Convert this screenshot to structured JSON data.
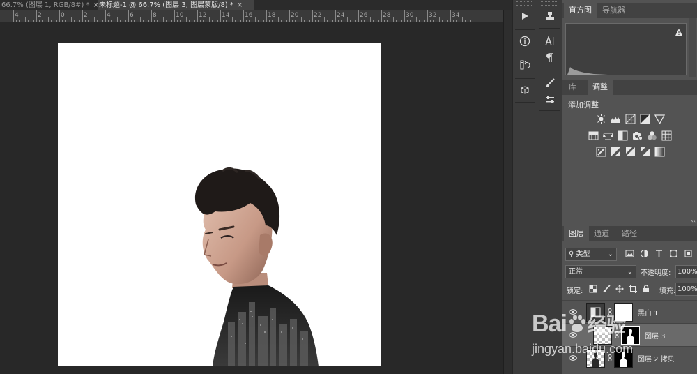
{
  "document_tabs": [
    {
      "label": "66.7% (图层 1, RGB/8#) *",
      "close": "×",
      "active": false
    },
    {
      "label": "未标题-1 @ 66.7% (图层 3, 图层蒙版/8) *",
      "close": "×",
      "active": true
    }
  ],
  "ruler": {
    "labels": [
      "4",
      "2",
      "0",
      "2",
      "4",
      "6",
      "8",
      "10",
      "12",
      "14",
      "16",
      "18",
      "20",
      "22",
      "24",
      "26",
      "28",
      "30",
      "32",
      "34"
    ]
  },
  "histogram_panel": {
    "tabs": [
      "直方图",
      "导航器"
    ],
    "active_tab": 0,
    "warning_icon": "warning-icon"
  },
  "adjustments_panel": {
    "tabs": [
      "库",
      "调整"
    ],
    "active_tab": 1,
    "heading": "添加调整",
    "icon_rows": [
      [
        "brightness-contrast-icon",
        "levels-icon",
        "curves-icon",
        "exposure-icon",
        "vibrance-icon"
      ],
      [
        "hue-saturation-icon",
        "color-balance-icon",
        "black-white-icon",
        "photo-filter-icon",
        "channel-mixer-icon",
        "color-lookup-icon"
      ],
      [
        "invert-icon",
        "posterize-icon",
        "threshold-icon",
        "selective-color-icon",
        "gradient-map-icon"
      ]
    ]
  },
  "layers_panel": {
    "tabs": [
      "图层",
      "通道",
      "路径"
    ],
    "active_tab": 0,
    "filter_kind": "类型",
    "blend_mode": "正常",
    "opacity_label": "不透明度:",
    "opacity_value": "100%",
    "lock_label": "锁定:",
    "fill_label": "填充:",
    "fill_value": "100%",
    "layers": [
      {
        "name": "黑白 1",
        "selected": false
      },
      {
        "name": "图层 3",
        "selected": true
      },
      {
        "name": "图层 2 拷贝",
        "selected": false
      }
    ]
  },
  "watermark": {
    "brand_prefix": "Bai",
    "brand_suffix": "经验",
    "url": "jingyan.baidu.com"
  },
  "colors": {
    "app_bg": "#282828",
    "panel_bg": "#535353",
    "canvas_bg": "#ffffff"
  }
}
